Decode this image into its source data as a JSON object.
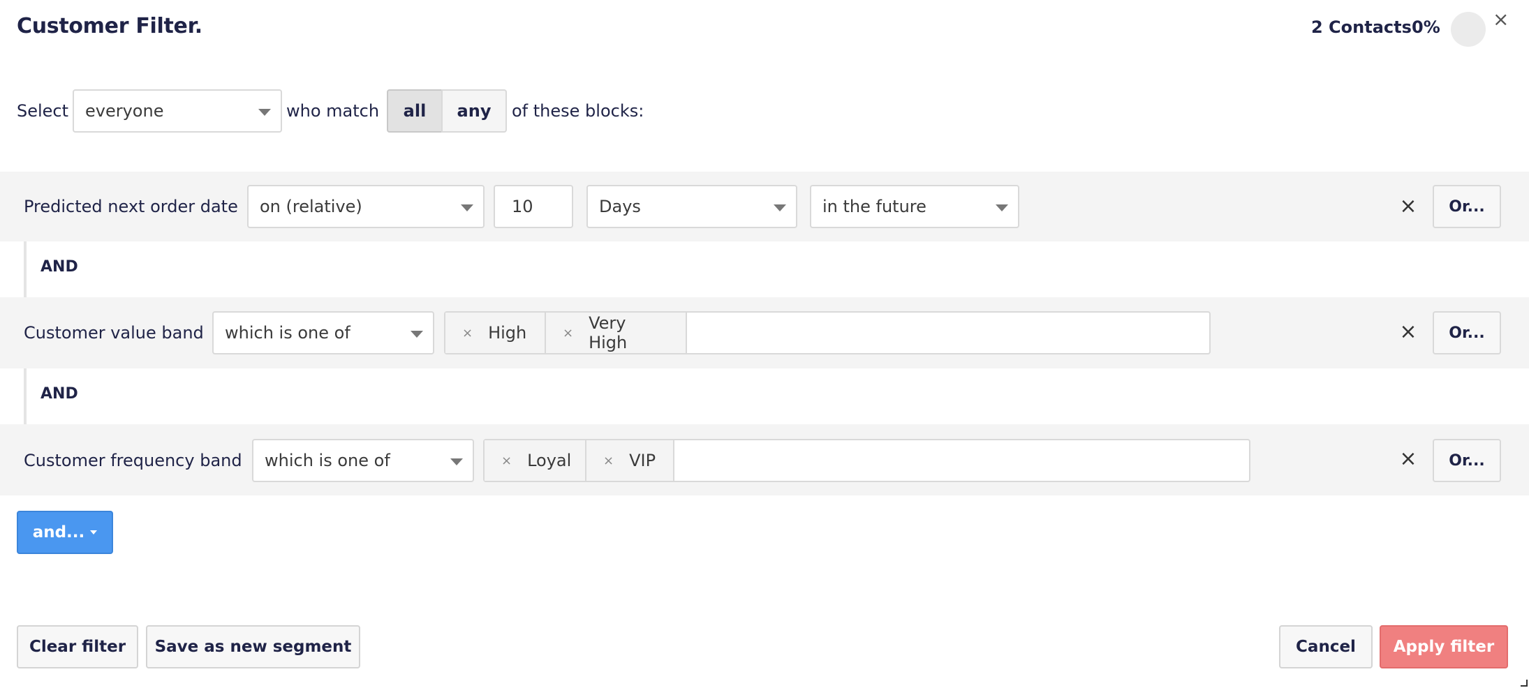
{
  "header": {
    "title": "Customer Filter.",
    "contacts": "2 Contacts",
    "percent": "0%",
    "close": "×"
  },
  "select_row": {
    "select_label": "Select",
    "audience": "everyone",
    "who_match": "who match",
    "match_all": "all",
    "match_any": "any",
    "match_selected": "all",
    "suffix": "of these blocks:"
  },
  "blocks": [
    {
      "label": "Predicted next order date",
      "operator": "on (relative)",
      "amount": "10",
      "unit": "Days",
      "direction": "in the future",
      "remove": "×",
      "or": "Or..."
    },
    {
      "label": "Customer value band",
      "operator": "which is one of",
      "tags": [
        "High",
        "Very High"
      ],
      "remove": "×",
      "or": "Or..."
    },
    {
      "label": "Customer frequency band",
      "operator": "which is one of",
      "tags": [
        "Loyal",
        "VIP"
      ],
      "remove": "×",
      "or": "Or..."
    }
  ],
  "and_separators": [
    "AND",
    "AND"
  ],
  "tag_remove": "×",
  "add_button": "and...",
  "footer": {
    "clear": "Clear filter",
    "save_segment": "Save as new segment",
    "cancel": "Cancel",
    "apply": "Apply filter"
  },
  "colors": {
    "primary_button": "#4a97f0",
    "apply_button": "#f08080",
    "text": "#1f2347"
  }
}
